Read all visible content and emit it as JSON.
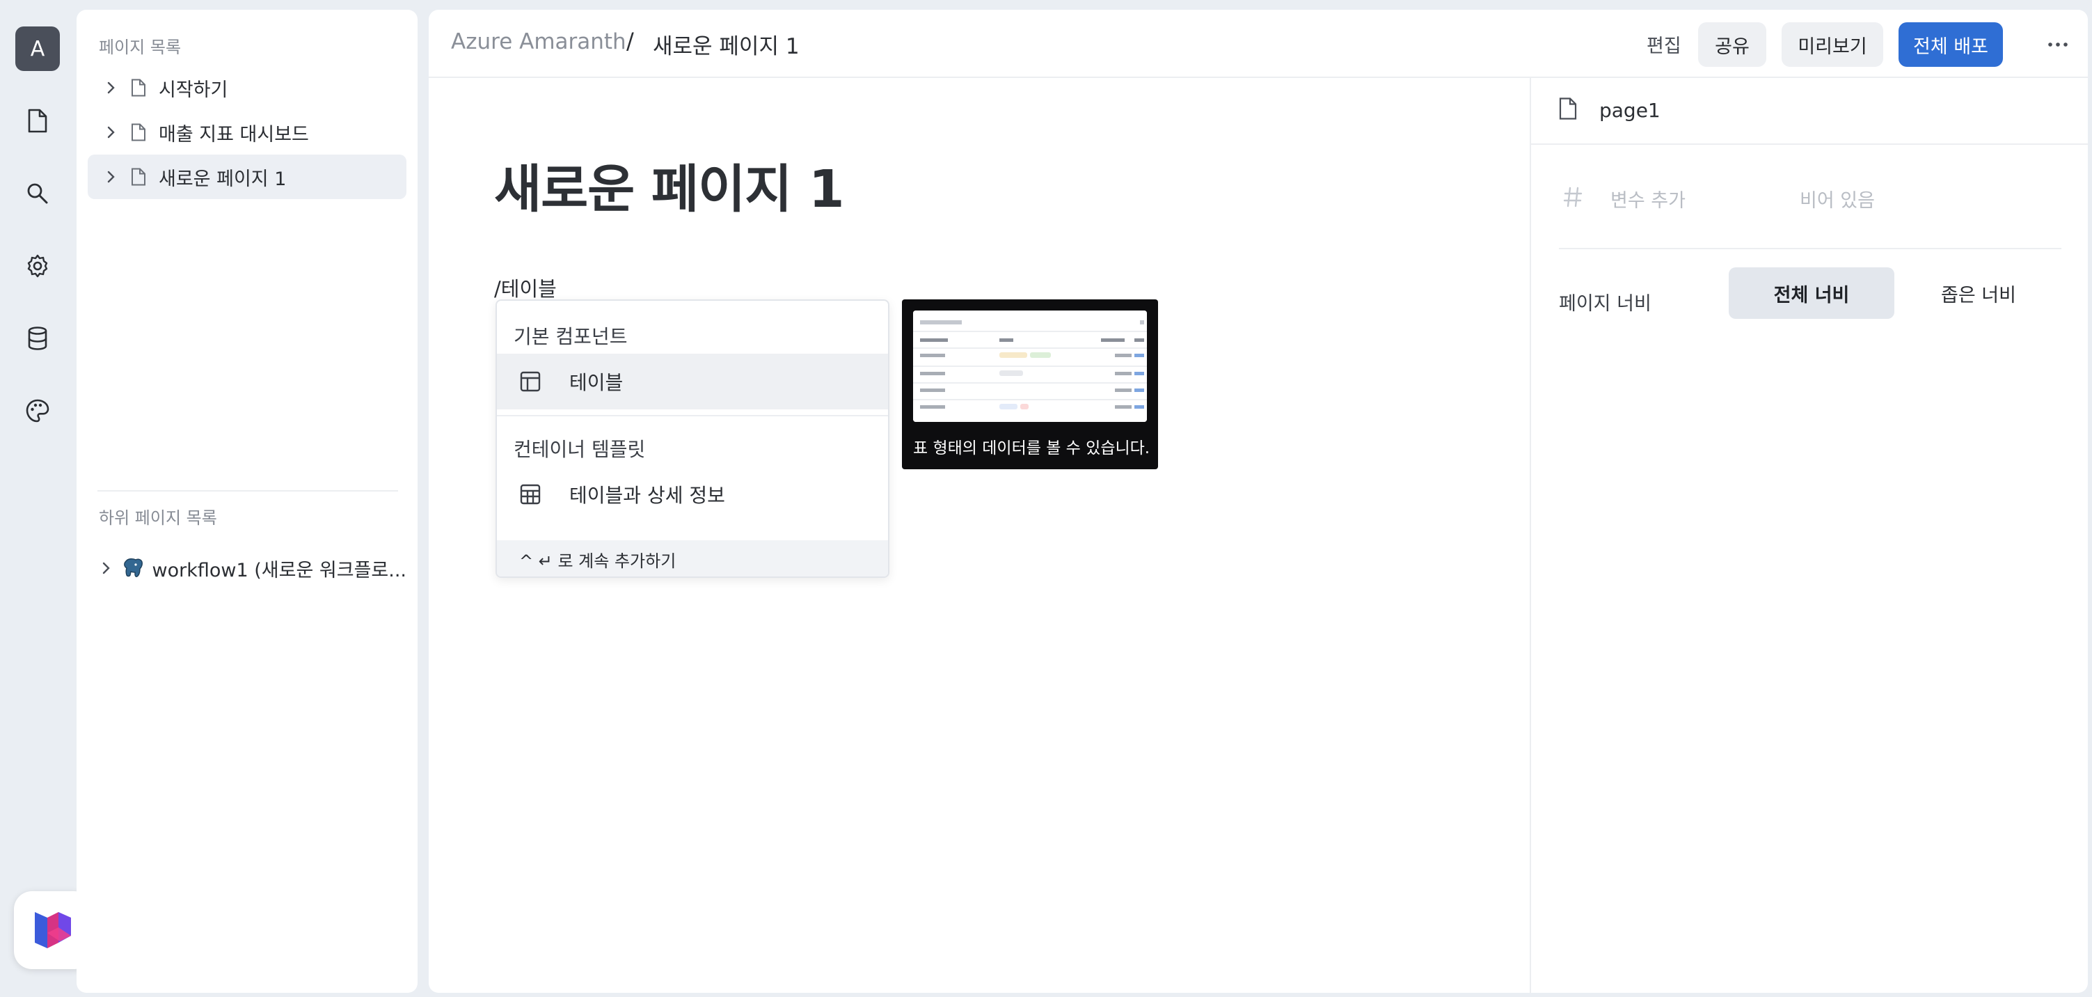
{
  "rail": {
    "avatar_letter": "A",
    "icons": [
      "document-icon",
      "search-icon",
      "gear-icon",
      "database-icon",
      "palette-icon"
    ]
  },
  "left_panel": {
    "pages_label": "페이지 목록",
    "pages": [
      {
        "label": "시작하기",
        "selected": false
      },
      {
        "label": "매출 지표 대시보드",
        "selected": false
      },
      {
        "label": "새로운 페이지 1",
        "selected": true
      }
    ],
    "subpages_label": "하위 페이지 목록",
    "subpages": [
      {
        "label": "workflow1 (새로운 워크플로..."
      }
    ]
  },
  "header": {
    "workspace": "Azure Amaranth",
    "separator": "/",
    "page": "새로운 페이지 1",
    "mode": "편집",
    "share_label": "공유",
    "preview_label": "미리보기",
    "deploy_label": "전체 배포",
    "accent": "#2f6ed4"
  },
  "editor": {
    "title": "새로운 페이지 1",
    "slash_prefix": "/테이",
    "slash_underlined": "블",
    "menu": {
      "section1": "기본 컴포넌트",
      "item1": "테이블",
      "section2": "컨테이너 템플릿",
      "item2": "테이블과 상세 정보",
      "footer": "^ ↵ 로 계속 추가하기"
    },
    "preview": {
      "caption": "표 형태의 데이터를 볼 수 있습니다."
    }
  },
  "inspector": {
    "page_name": "page1",
    "variable_placeholder": "변수 추가",
    "variable_value_placeholder": "비어 있음",
    "page_width_label": "페이지 너비",
    "full_width_label": "전체 너비",
    "narrow_width_label": "좁은 너비",
    "selected_width": "전체 너비"
  }
}
